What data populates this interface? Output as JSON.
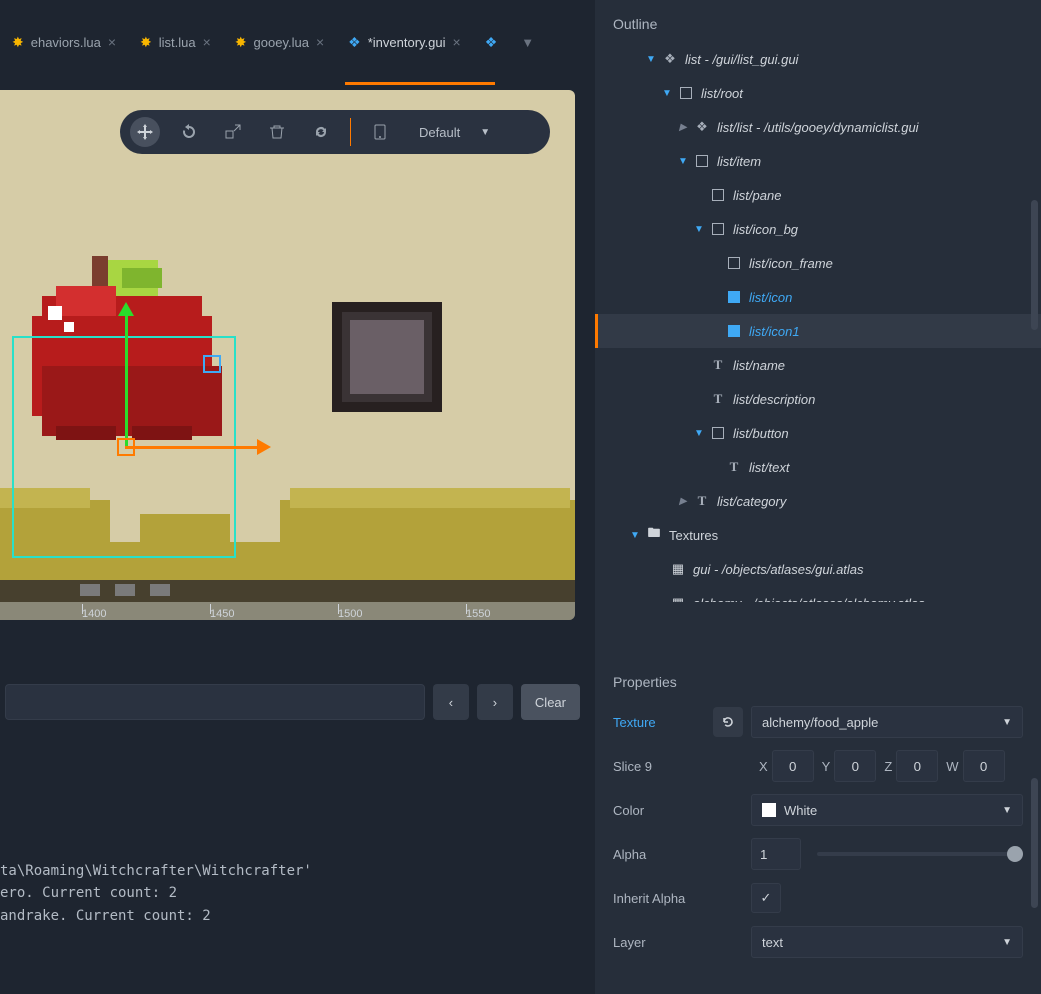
{
  "tabs": [
    {
      "label": "ehaviors.lua",
      "icon": "gear"
    },
    {
      "label": "list.lua",
      "icon": "gear"
    },
    {
      "label": "gooey.lua",
      "icon": "gear"
    },
    {
      "label": "*inventory.gui",
      "icon": "stack",
      "active": true
    }
  ],
  "toolbar": {
    "mode": "Default"
  },
  "ruler": {
    "ticks": [
      "1400",
      "1450",
      "1500",
      "1550"
    ]
  },
  "console": {
    "clear_label": "Clear",
    "log": "ta\\Roaming\\Witchcrafter\\Witchcrafter'\nero. Current count: 2\nandrake. Current count: 2"
  },
  "outline": {
    "title": "Outline",
    "nodes": [
      {
        "label": "list - /gui/list_gui.gui",
        "depth": 0,
        "arrow": "expanded",
        "icon": "stack"
      },
      {
        "label": "list/root",
        "depth": 1,
        "arrow": "expanded",
        "icon": "box"
      },
      {
        "label": "list/list - /utils/gooey/dynamiclist.gui",
        "depth": 2,
        "arrow": "collapsed",
        "icon": "stack"
      },
      {
        "label": "list/item",
        "depth": 2,
        "arrow": "expanded",
        "icon": "box"
      },
      {
        "label": "list/pane",
        "depth": 3,
        "arrow": "",
        "icon": "box"
      },
      {
        "label": "list/icon_bg",
        "depth": 3,
        "arrow": "expanded",
        "icon": "box"
      },
      {
        "label": "list/icon_frame",
        "depth": 4,
        "arrow": "",
        "icon": "box"
      },
      {
        "label": "list/icon",
        "depth": 4,
        "arrow": "",
        "icon": "box-filled",
        "selected": "primary"
      },
      {
        "label": "list/icon1",
        "depth": 4,
        "arrow": "",
        "icon": "box-filled",
        "selected": "secondary"
      },
      {
        "label": "list/name",
        "depth": 3,
        "arrow": "",
        "icon": "text"
      },
      {
        "label": "list/description",
        "depth": 3,
        "arrow": "",
        "icon": "text"
      },
      {
        "label": "list/button",
        "depth": 3,
        "arrow": "expanded",
        "icon": "box"
      },
      {
        "label": "list/text",
        "depth": 4,
        "arrow": "",
        "icon": "text"
      },
      {
        "label": "list/category",
        "depth": 2,
        "arrow": "collapsed",
        "icon": "text"
      }
    ],
    "textures": {
      "header": "Textures",
      "items": [
        "gui - /objects/atlases/gui.atlas",
        "alchemy - /objects/atlases/alchemy.atlas"
      ]
    }
  },
  "properties": {
    "title": "Properties",
    "texture": {
      "label": "Texture",
      "value": "alchemy/food_apple"
    },
    "slice9": {
      "label": "Slice 9",
      "x": "0",
      "y": "0",
      "z": "0",
      "w": "0"
    },
    "color": {
      "label": "Color",
      "value": "White"
    },
    "alpha": {
      "label": "Alpha",
      "value": "1"
    },
    "inherit_alpha": {
      "label": "Inherit Alpha",
      "checked": true
    },
    "layer": {
      "label": "Layer",
      "value": "text"
    }
  }
}
